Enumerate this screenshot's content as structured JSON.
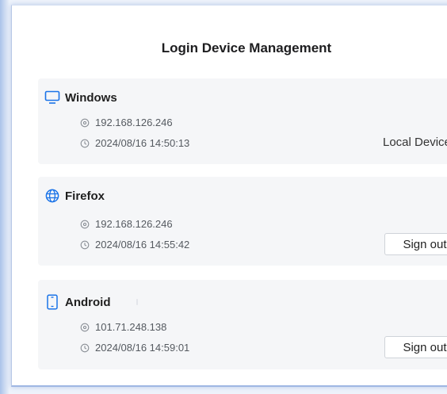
{
  "dialog": {
    "title": "Login Device Management",
    "devices": [
      {
        "name": "Windows",
        "icon": "monitor-icon",
        "ip": "192.168.126.246",
        "time": "2024/08/16 14:50:13",
        "action": "Local Device"
      },
      {
        "name": "Firefox",
        "icon": "globe-icon",
        "ip": "192.168.126.246",
        "time": "2024/08/16 14:55:42",
        "action": "Sign out"
      },
      {
        "name": "Android",
        "icon": "phone-icon",
        "ip": "101.71.248.138",
        "time": "2024/08/16 14:59:01",
        "action": "Sign out"
      }
    ]
  },
  "colors": {
    "accent": "#1a73e8",
    "card_bg": "#f5f6f8",
    "window_frame": "#9fb7e3"
  }
}
